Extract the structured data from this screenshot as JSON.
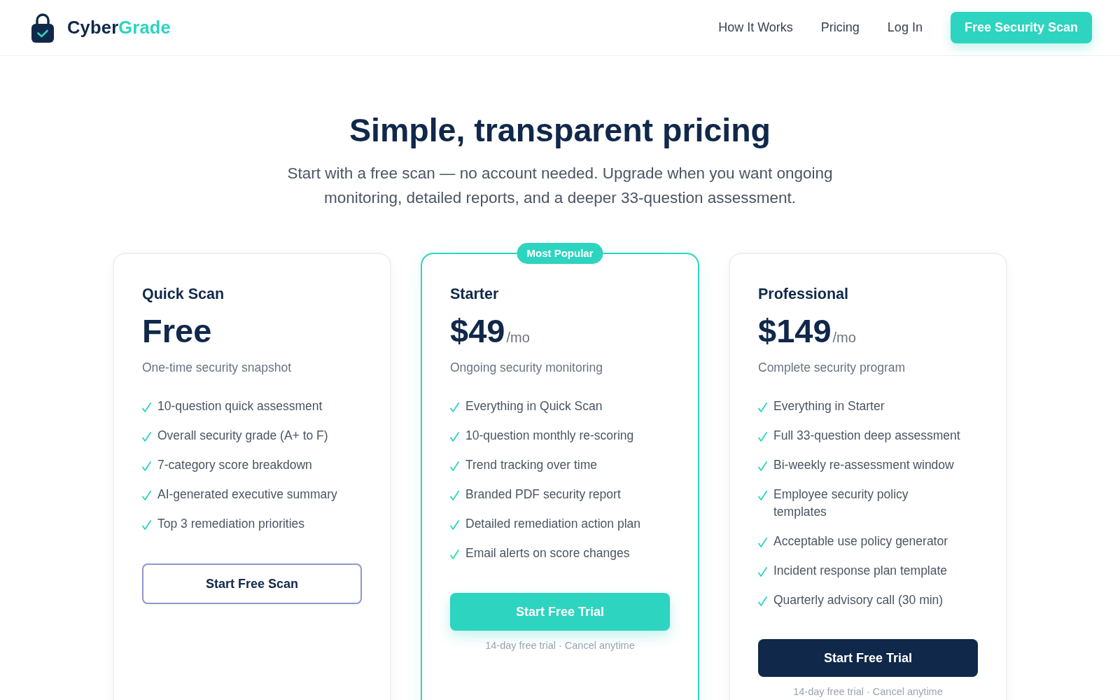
{
  "header": {
    "brand": {
      "name": "Cyber",
      "accent": "Grade"
    },
    "nav": [
      {
        "label": "How It Works"
      },
      {
        "label": "Pricing"
      },
      {
        "label": "Log In"
      }
    ],
    "cta": "Free Security Scan"
  },
  "hero": {
    "title": "Simple, transparent pricing",
    "subtitle": "Start with a free scan — no account needed. Upgrade when you want ongoing monitoring, detailed reports, and a deeper 33-question assessment."
  },
  "plans": [
    {
      "name": "Quick Scan",
      "featured": false,
      "price": "Free",
      "description": "One-time security snapshot",
      "features": [
        "10-question quick assessment",
        "Overall security grade (A+ to F)",
        "7-category score breakdown",
        "AI-generated executive summary",
        "Top 3 remediation priorities"
      ],
      "button": {
        "label": "Start Free Scan",
        "kind": "outline"
      }
    },
    {
      "name": "Starter",
      "featured": true,
      "badge": "Most Popular",
      "price": "$49",
      "period": "/mo",
      "description": "Ongoing security monitoring",
      "features": [
        "Everything in Quick Scan",
        "10-question monthly re-scoring",
        "Trend tracking over time",
        "Branded PDF security report",
        "Detailed remediation action plan",
        "Email alerts on score changes"
      ],
      "button": {
        "label": "Start Free Trial",
        "kind": "primary"
      },
      "note": "14-day free trial · Cancel anytime"
    },
    {
      "name": "Professional",
      "featured": false,
      "price": "$149",
      "period": "/mo",
      "description": "Complete security program",
      "features": [
        "Everything in Starter",
        "Full 33-question deep assessment",
        "Bi-weekly re-assessment window",
        "Employee security policy templates",
        "Acceptable use policy generator",
        "Incident response plan template",
        "Quarterly advisory call (30 min)"
      ],
      "button": {
        "label": "Start Free Trial",
        "kind": "dark"
      },
      "note": "14-day free trial · Cancel anytime"
    }
  ]
}
